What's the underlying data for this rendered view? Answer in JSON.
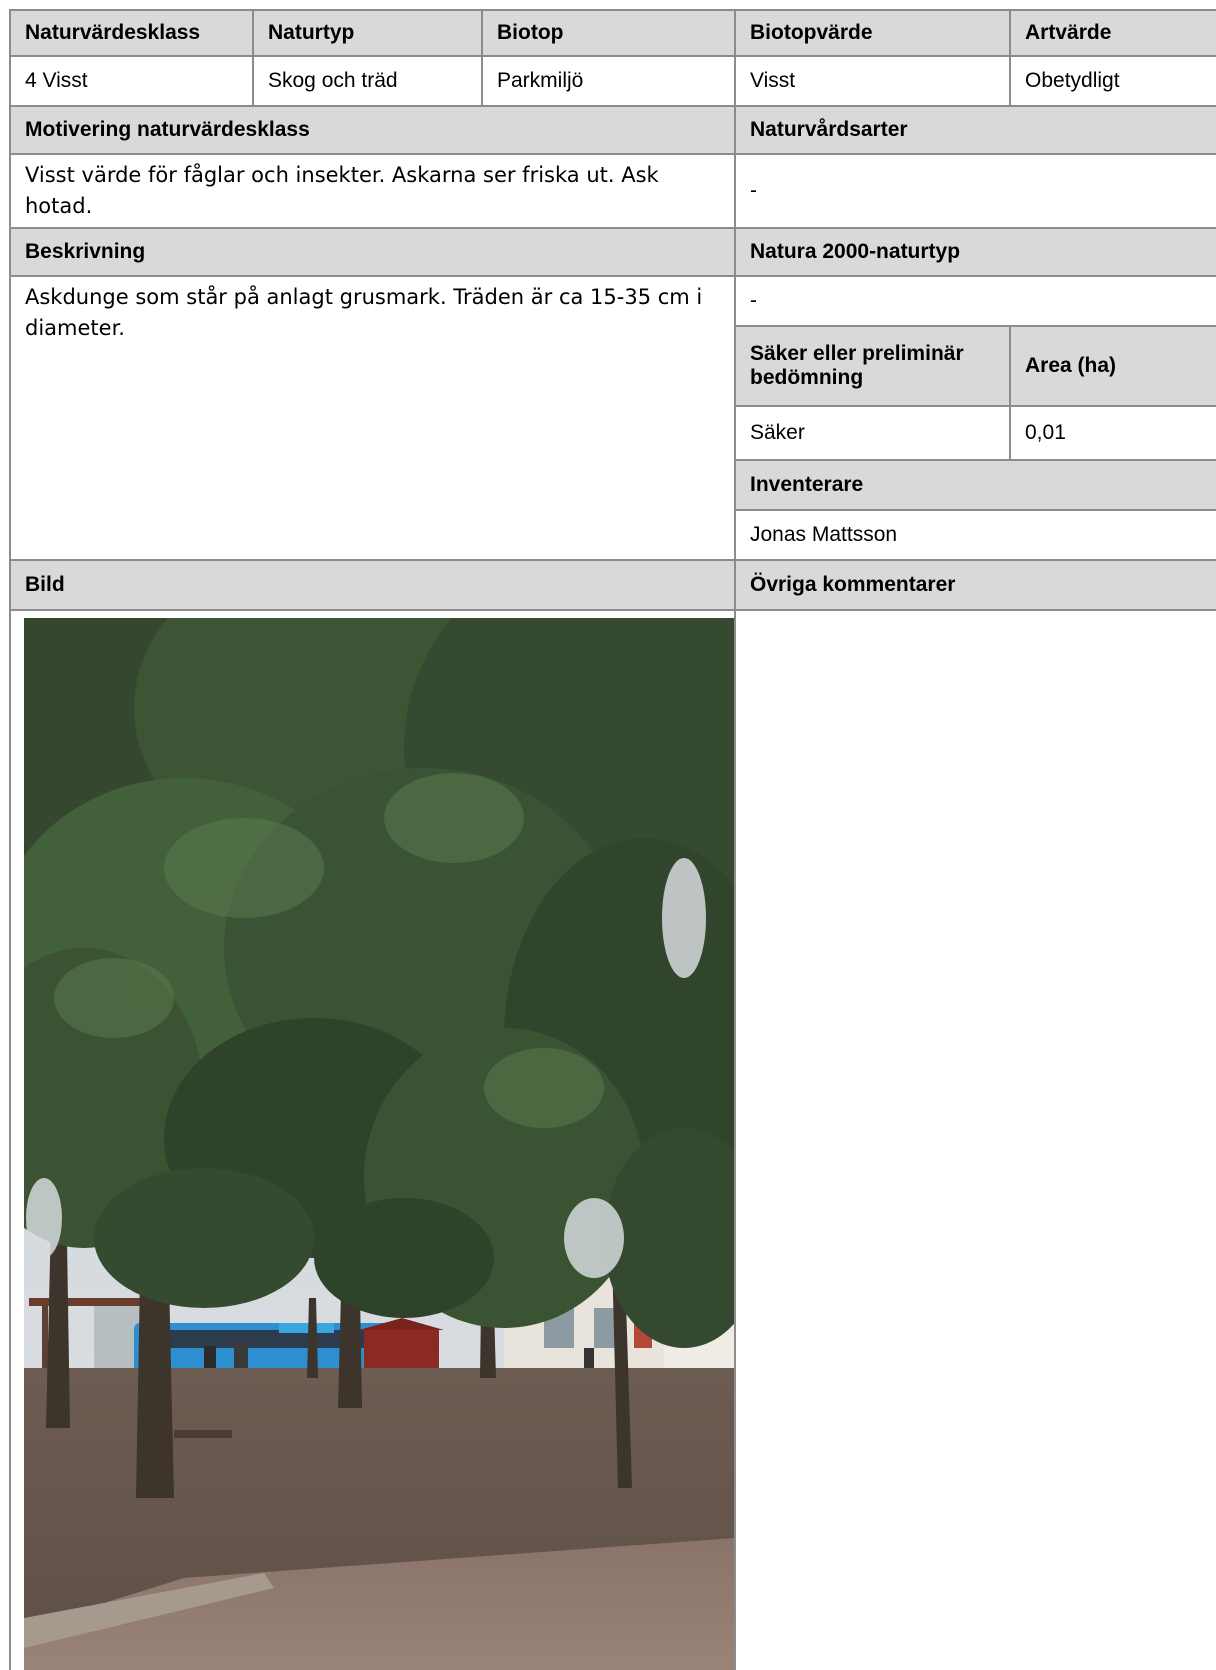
{
  "top_headers": [
    "Naturvärdesklass",
    "Naturtyp",
    "Biotop",
    "Biotopvärde",
    "Artvärde"
  ],
  "top_values": [
    "4 Visst",
    "Skog och träd",
    "Parkmiljö",
    "Visst",
    "Obetydligt"
  ],
  "motivering": {
    "header": "Motivering naturvärdesklass",
    "text": "Visst värde för fåglar och insekter. Askarna ser friska ut. Ask hotad."
  },
  "naturvardsarter": {
    "header": "Naturvårdsarter",
    "value": "-"
  },
  "beskrivning": {
    "header": "Beskrivning",
    "text": "Askdunge som står på anlagt grusmark. Träden är ca 15-35 cm i diameter."
  },
  "natura2000": {
    "header": "Natura 2000-naturtyp",
    "value": "-"
  },
  "bedomning": {
    "header": "Säker eller preliminär bedömning",
    "value": "Säker"
  },
  "area": {
    "header": "Area (ha)",
    "value": "0,01"
  },
  "inventerare": {
    "header": "Inventerare",
    "value": "Jonas Mattsson"
  },
  "bild": {
    "header": "Bild"
  },
  "ovriga": {
    "header": "Övriga kommentarer"
  }
}
